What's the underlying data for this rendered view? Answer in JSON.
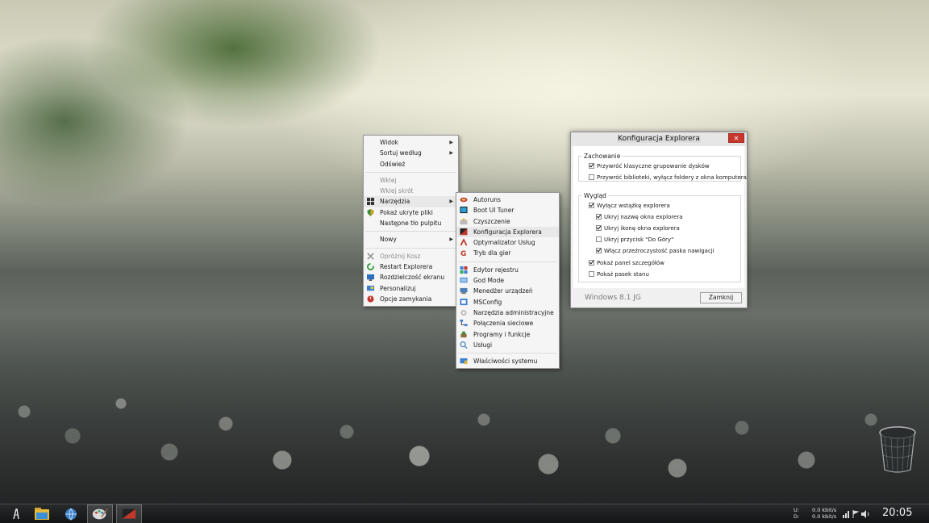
{
  "context_menu": {
    "items": [
      {
        "label": "Widok",
        "submenu": true,
        "disabled": false
      },
      {
        "label": "Sortuj według",
        "submenu": true,
        "disabled": false
      },
      {
        "label": "Odśwież",
        "submenu": false,
        "disabled": false
      },
      {
        "label": "Wklej",
        "submenu": false,
        "disabled": true
      },
      {
        "label": "Wklej skrót",
        "submenu": false,
        "disabled": true
      },
      {
        "label": "Narzędzia",
        "submenu": true,
        "disabled": false,
        "icon": "windows-logo-icon"
      },
      {
        "label": "Pokaż ukryte pliki",
        "submenu": false,
        "disabled": false,
        "icon": "shield-icon"
      },
      {
        "label": "Następne tło pulpitu",
        "submenu": false,
        "disabled": false
      },
      {
        "label": "Nowy",
        "submenu": true,
        "disabled": false
      },
      {
        "label": "Opróżnij Kosz",
        "submenu": false,
        "disabled": true,
        "icon": "empty-trash-icon"
      },
      {
        "label": "Restart Explorera",
        "submenu": false,
        "disabled": false,
        "icon": "restart-icon"
      },
      {
        "label": "Rozdzielczość ekranu",
        "submenu": false,
        "disabled": false,
        "icon": "monitor-icon"
      },
      {
        "label": "Personalizuj",
        "submenu": false,
        "disabled": false,
        "icon": "personalize-icon"
      },
      {
        "label": "Opcje zamykania",
        "submenu": false,
        "disabled": false,
        "icon": "power-icon"
      }
    ]
  },
  "tools_submenu": {
    "items": [
      {
        "label": "Autoruns",
        "icon": "autoruns-icon"
      },
      {
        "label": "Boot UI Tuner",
        "icon": "boot-ui-icon"
      },
      {
        "label": "Czyszczenie",
        "icon": "cleanup-icon"
      },
      {
        "label": "Konfiguracja Explorera",
        "icon": "explorer-config-icon"
      },
      {
        "label": "Optymalizator Usług",
        "icon": "services-optimizer-icon"
      },
      {
        "label": "Tryb dla gier",
        "icon": "game-mode-icon"
      },
      {
        "label": "Edytor rejestru",
        "icon": "registry-icon"
      },
      {
        "label": "God Mode",
        "icon": "god-mode-icon"
      },
      {
        "label": "Menedżer urządzeń",
        "icon": "device-manager-icon"
      },
      {
        "label": "MSConfig",
        "icon": "msconfig-icon"
      },
      {
        "label": "Narzędzia administracyjne",
        "icon": "admin-tools-icon"
      },
      {
        "label": "Połączenia sieciowe",
        "icon": "network-icon"
      },
      {
        "label": "Programy i funkcje",
        "icon": "programs-icon"
      },
      {
        "label": "Usługi",
        "icon": "services-icon"
      },
      {
        "label": "Właściwości systemu",
        "icon": "system-properties-icon"
      }
    ]
  },
  "dialog": {
    "title": "Konfiguracja Explorera",
    "close_label": "✕",
    "group1_title": "Zachowanie",
    "group1_options": [
      {
        "label": "Przywróć klasyczne grupowanie dysków",
        "checked": true
      },
      {
        "label": "Przywróć biblioteki, wyłącz foldery z okna komputera",
        "checked": false
      }
    ],
    "group2_title": "Wygląd",
    "group2_options": [
      {
        "label": "Wyłącz wstążkę explorera",
        "checked": true,
        "indent": 0
      },
      {
        "label": "Ukryj nazwę okna explorera",
        "checked": true,
        "indent": 1
      },
      {
        "label": "Ukryj ikonę okna explorera",
        "checked": true,
        "indent": 1
      },
      {
        "label": "Ukryj przycisk \"Do Góry\"",
        "checked": false,
        "indent": 1
      },
      {
        "label": "Włącz przeźroczystość paska nawigacji",
        "checked": true,
        "indent": 1
      },
      {
        "label": "Pokaż panel szczegółów",
        "checked": true,
        "indent": 0
      },
      {
        "label": "Pokaż pasek stanu",
        "checked": false,
        "indent": 0
      }
    ],
    "footer_text": "Windows 8.1 JG",
    "button_label": "Zamknij"
  },
  "taskbar": {
    "buttons": [
      "start-icon",
      "file-explorer-icon",
      "network-globe-icon",
      "paint-icon",
      "explorer-config-app-icon"
    ],
    "net_labels": [
      "U:",
      "D:"
    ],
    "net_values": [
      "0.0 kbit/s",
      "0.0 kbit/s"
    ],
    "clock": "20:05"
  },
  "colors": {
    "close_red": "#c7372c",
    "menu_bg": "#f5f5f5",
    "disabled_text": "#8d8d8d"
  }
}
